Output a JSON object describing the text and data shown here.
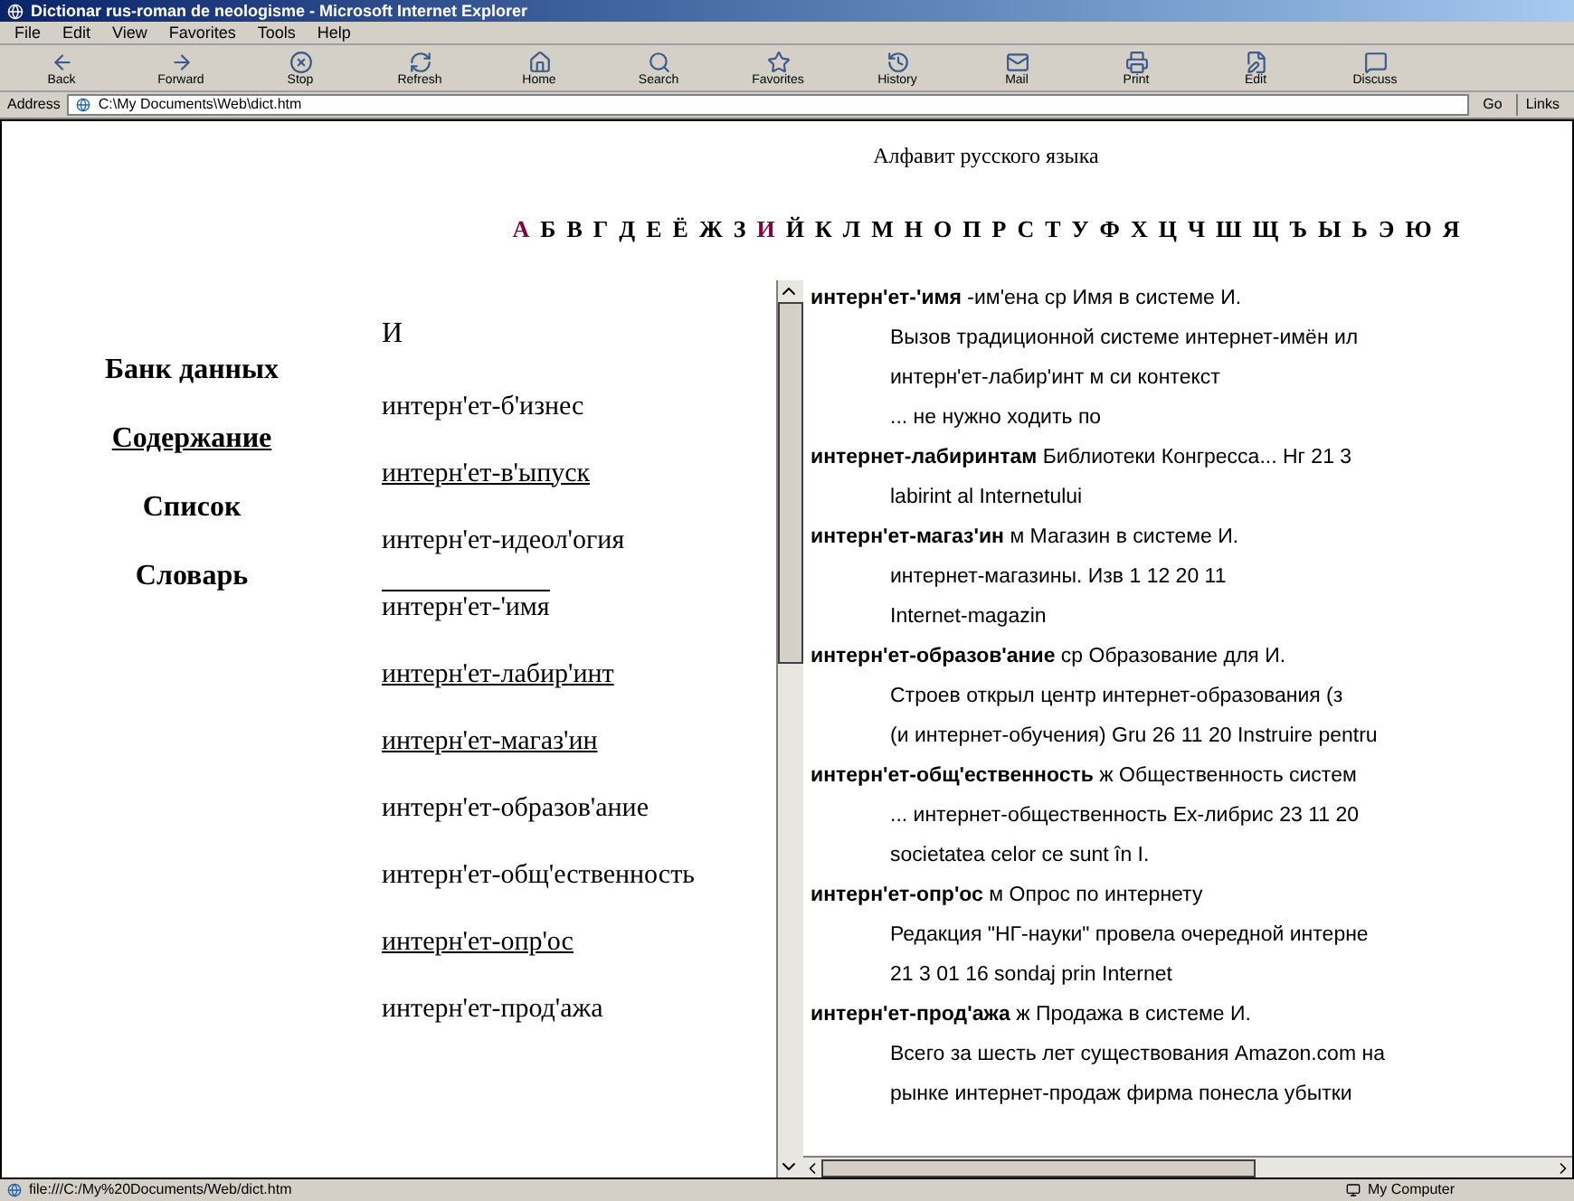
{
  "window": {
    "title": "Dictionar rus-roman de neologisme - Microsoft Internet Explorer"
  },
  "menu": [
    "File",
    "Edit",
    "View",
    "Favorites",
    "Tools",
    "Help"
  ],
  "toolbar": [
    {
      "kind": "back",
      "label": "Back"
    },
    {
      "kind": "forward",
      "label": "Forward"
    },
    {
      "kind": "stop",
      "label": "Stop"
    },
    {
      "kind": "refresh",
      "label": "Refresh"
    },
    {
      "kind": "home",
      "label": "Home"
    },
    {
      "kind": "search",
      "label": "Search"
    },
    {
      "kind": "favorites",
      "label": "Favorites"
    },
    {
      "kind": "history",
      "label": "History"
    },
    {
      "kind": "mail",
      "label": "Mail"
    },
    {
      "kind": "print",
      "label": "Print"
    },
    {
      "kind": "edit",
      "label": "Edit"
    },
    {
      "kind": "discuss",
      "label": "Discuss"
    }
  ],
  "address": {
    "label": "Address",
    "value": "C:\\My Documents\\Web\\dict.htm",
    "go": "Go",
    "links": "Links"
  },
  "page": {
    "heading": "Алфавит русского языка",
    "alphabet": [
      {
        "letter": "А",
        "visited": true
      },
      {
        "letter": "Б",
        "visited": false
      },
      {
        "letter": "В",
        "visited": false
      },
      {
        "letter": "Г",
        "visited": false
      },
      {
        "letter": "Д",
        "visited": false
      },
      {
        "letter": "Е",
        "visited": false
      },
      {
        "letter": "Ё",
        "visited": false
      },
      {
        "letter": "Ж",
        "visited": false
      },
      {
        "letter": "З",
        "visited": false
      },
      {
        "letter": "И",
        "visited": true
      },
      {
        "letter": "Й",
        "visited": false
      },
      {
        "letter": "К",
        "visited": false
      },
      {
        "letter": "Л",
        "visited": false
      },
      {
        "letter": "М",
        "visited": false
      },
      {
        "letter": "Н",
        "visited": false
      },
      {
        "letter": "О",
        "visited": false
      },
      {
        "letter": "П",
        "visited": false
      },
      {
        "letter": "Р",
        "visited": false
      },
      {
        "letter": "С",
        "visited": false
      },
      {
        "letter": "Т",
        "visited": false
      },
      {
        "letter": "У",
        "visited": false
      },
      {
        "letter": "Ф",
        "visited": false
      },
      {
        "letter": "Х",
        "visited": false
      },
      {
        "letter": "Ц",
        "visited": false
      },
      {
        "letter": "Ч",
        "visited": false
      },
      {
        "letter": "Ш",
        "visited": false
      },
      {
        "letter": "Щ",
        "visited": false
      },
      {
        "letter": "Ъ",
        "visited": false
      },
      {
        "letter": "Ы",
        "visited": false
      },
      {
        "letter": "Ь",
        "visited": false
      },
      {
        "letter": "Э",
        "visited": false
      },
      {
        "letter": "Ю",
        "visited": false
      },
      {
        "letter": "Я",
        "visited": false
      }
    ],
    "nav": [
      {
        "label": "Банк данных",
        "linked": false
      },
      {
        "label": "Содержание",
        "linked": true
      },
      {
        "label": "Список",
        "linked": false
      },
      {
        "label": "Словарь",
        "linked": false
      }
    ],
    "letter_heading": "И",
    "words": [
      {
        "label": "интерн'ет-б'изнес",
        "linked": false,
        "selected": false
      },
      {
        "label": "интерн'ет-в'ыпуск",
        "linked": true,
        "selected": false
      },
      {
        "label": "интерн'ет-идеол'огия",
        "linked": false,
        "selected": false
      },
      {
        "label": "интерн'ет-'имя",
        "linked": false,
        "selected": true
      },
      {
        "label": "интерн'ет-лабир'инт",
        "linked": true,
        "selected": false
      },
      {
        "label": "интерн'ет-магаз'ин",
        "linked": true,
        "selected": false
      },
      {
        "label": "интерн'ет-образов'ание",
        "linked": false,
        "selected": false
      },
      {
        "label": "интерн'ет-общ'ественность",
        "linked": false,
        "selected": false
      },
      {
        "label": "интерн'ет-опр'ос",
        "linked": true,
        "selected": false
      },
      {
        "label": "интерн'ет-прод'ажа",
        "linked": false,
        "selected": false
      }
    ],
    "entries": [
      {
        "kind": "head",
        "text": "**интерн'ет-'имя** -им'ена ср Имя в системе И."
      },
      {
        "kind": "text",
        "text": "Вызов традиционной системе интернет-имён ил"
      },
      {
        "kind": "text",
        "text": "интерн'ет-лабир'инт м си контекст"
      },
      {
        "kind": "text",
        "text": "... не нужно ходить по"
      },
      {
        "kind": "head",
        "text": "**интернет-лабиринтам** Библиотеки Конгресса... Нг 21 3"
      },
      {
        "kind": "text",
        "text": "labirint al Internetului"
      },
      {
        "kind": "head",
        "text": "**интерн'ет-магаз'ин** м Магазин в системе И."
      },
      {
        "kind": "text",
        "text": "интернет-магазины. Изв 1 12 20 11"
      },
      {
        "kind": "text",
        "text": "Internet-magazin"
      },
      {
        "kind": "head",
        "text": "**интерн'ет-образов'ание** ср Образование для И."
      },
      {
        "kind": "text",
        "text": "Строев открыл центр интернет-образования (з"
      },
      {
        "kind": "text",
        "text": "(и интернет-обучения) Gru 26 11 20 Instruire pentru"
      },
      {
        "kind": "head",
        "text": "**интерн'ет-общ'ественность** ж Общественность систем"
      },
      {
        "kind": "text",
        "text": "... интернет-общественность Ex-либрис 23 11 20"
      },
      {
        "kind": "text",
        "text": "societatea celor ce sunt în I."
      },
      {
        "kind": "head",
        "text": "**интерн'ет-опр'ос** м Опрос по интернету"
      },
      {
        "kind": "text",
        "text": "Редакция \"НГ-науки\" провела очередной интерне"
      },
      {
        "kind": "text",
        "text": "21 3 01 16 sondaj prin Internet"
      },
      {
        "kind": "head",
        "text": "**интерн'ет-прод'ажа** ж Продажа в системе И."
      },
      {
        "kind": "text",
        "text": "Всего за шесть лет существования Amazon.com на"
      },
      {
        "kind": "text",
        "text": "рынке интернет-продаж фирма понесла убытки"
      }
    ]
  },
  "status_bar": {
    "text": "file:///C:/My%20Documents/Web/dict.htm",
    "zone": "My Computer"
  }
}
